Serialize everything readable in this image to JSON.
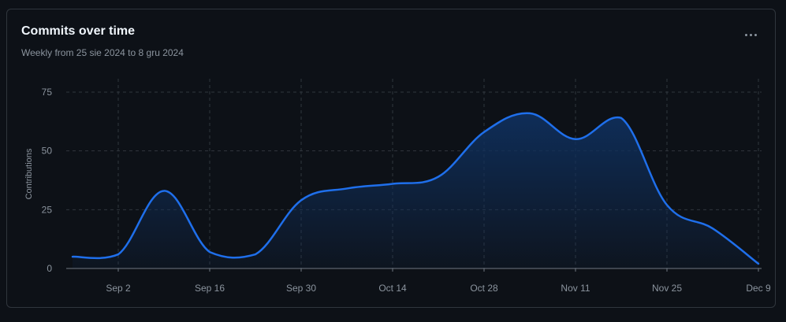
{
  "card": {
    "title": "Commits over time",
    "subtitle": "Weekly from 25 sie 2024 to 8 gru 2024",
    "menu_icon": "kebab-horizontal-icon"
  },
  "colors": {
    "background": "#0d1117",
    "line": "#1f6feb",
    "area_top": "#0d2a55",
    "grid": "#30363d",
    "text_muted": "#8b949e"
  },
  "chart_data": {
    "type": "area",
    "title": "Commits over time",
    "ylabel": "Contributions",
    "ylim": [
      0,
      75
    ],
    "yticks": [
      0,
      25,
      50,
      75
    ],
    "xticks": [
      "Sep 2",
      "Sep 16",
      "Sep 30",
      "Oct 14",
      "Oct 28",
      "Nov 11",
      "Nov 25",
      "Dec 9"
    ],
    "grid": true,
    "series": [
      {
        "x": [
          "Aug 25",
          "Sep 1",
          "Sep 8",
          "Sep 15",
          "Sep 22",
          "Sep 29",
          "Oct 6",
          "Oct 13",
          "Oct 20",
          "Oct 27",
          "Nov 3",
          "Nov 10",
          "Nov 17",
          "Nov 24",
          "Dec 1",
          "Dec 8"
        ],
        "values": [
          5,
          6,
          33,
          7,
          6,
          29,
          34,
          36,
          39,
          58,
          66,
          55,
          64,
          27,
          17,
          2
        ]
      }
    ]
  }
}
